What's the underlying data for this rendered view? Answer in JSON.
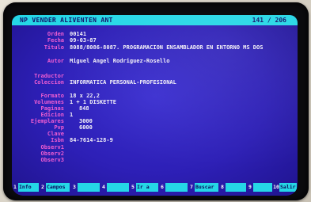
{
  "titlebar": {
    "name": "NP VENDER ALIVENTEN ANT",
    "counter": "141 / 206"
  },
  "record": {
    "orden": {
      "label": "Orden",
      "value": "00141"
    },
    "fecha": {
      "label": "Fecha",
      "value": "09-03-87"
    },
    "titulo": {
      "label": "Titulo",
      "value": "8088/8086-8087. PROGRAMACION ENSAMBLADOR EN ENTORNO MS DOS"
    },
    "autor": {
      "label": "Autor",
      "value": "Miguel Angel Rodriguez-Rosello"
    },
    "traductor": {
      "label": "Traductor",
      "value": ""
    },
    "coleccion": {
      "label": "Coleccion",
      "value": "INFORMATICA PERSONAL-PROFESIONAL"
    },
    "formato": {
      "label": "Formato",
      "value": "18 x 22,2"
    },
    "volumenes": {
      "label": "Volumenes",
      "value": "1 + 1 DISKETTE"
    },
    "paginas": {
      "label": "Paginas",
      "value": "848"
    },
    "edicion": {
      "label": "Edicion",
      "value": "1"
    },
    "ejemplares": {
      "label": "Ejemplares",
      "value": "3000"
    },
    "pvp": {
      "label": "Pvp",
      "value": "6000"
    },
    "clave": {
      "label": "Clave",
      "value": ""
    },
    "isbn": {
      "label": "Isbn",
      "value": "84-7614-128-9"
    },
    "observ1": {
      "label": "Observ1",
      "value": ""
    },
    "observ2": {
      "label": "Observ2",
      "value": ""
    },
    "observ3": {
      "label": "Observ3",
      "value": ""
    }
  },
  "fkeys": [
    {
      "num": "1",
      "label": "Info"
    },
    {
      "num": "2",
      "label": "Campos"
    },
    {
      "num": "3",
      "label": ""
    },
    {
      "num": "4",
      "label": ""
    },
    {
      "num": "5",
      "label": "Ir a"
    },
    {
      "num": "6",
      "label": ""
    },
    {
      "num": "7",
      "label": "Buscar"
    },
    {
      "num": "8",
      "label": ""
    },
    {
      "num": "9",
      "label": ""
    },
    {
      "num": "10",
      "label": "Salir"
    }
  ],
  "colors": {
    "screen": "#2d1fb6",
    "titlebar": "#25d7e6",
    "label": "#f05dd2",
    "value": "#f4f1f8"
  }
}
